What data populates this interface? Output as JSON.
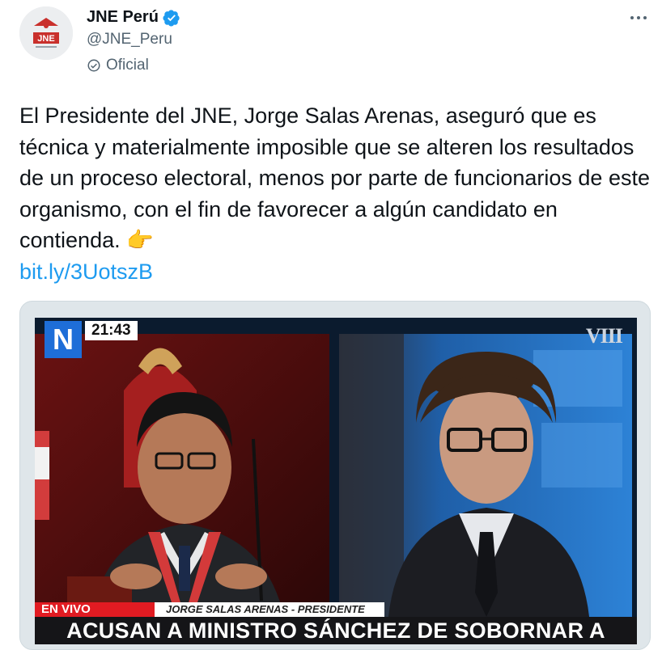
{
  "account": {
    "name": "JNE Perú",
    "handle": "@JNE_Peru",
    "badge_label": "Oficial",
    "avatar_text": "JNE"
  },
  "tweet": {
    "text": "El Presidente del JNE, Jorge Salas Arenas, aseguró que es técnica y materialmente imposible que se alteren los resultados de un proceso electoral, menos por parte de funcionarios de este organismo, con el fin de favorecer a algún candidato en contienda.",
    "emoji": "👉",
    "link": "bit.ly/3UotszB"
  },
  "media": {
    "channel_logo": "N",
    "clock": "21:43",
    "watermark": "VIII",
    "live_label": "EN VIVO",
    "caption": "JORGE SALAS ARENAS - PRESIDENTE DEL JNE",
    "headline": "ACUSAN A MINISTRO SÁNCHEZ DE SOBORNAR A FUNCIONARIOS DEL JNE"
  },
  "colors": {
    "link": "#1d9bf0",
    "verified": "#1d9bf0",
    "live_red": "#e11b22"
  }
}
